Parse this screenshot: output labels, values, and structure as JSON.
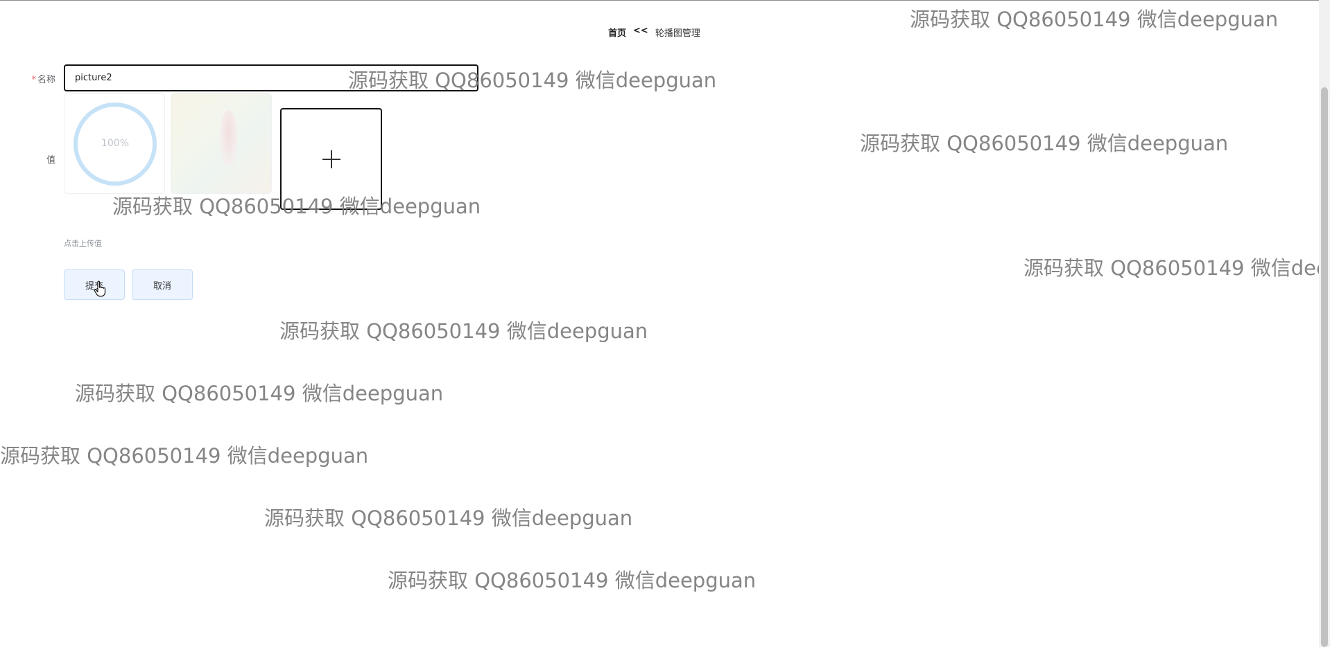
{
  "breadcrumb": {
    "home": "首页",
    "separator": "<<",
    "current": "轮播图管理"
  },
  "form": {
    "name_label": "名称",
    "required_mark": "*",
    "name_value": "picture2",
    "value_label": "值",
    "upload_progress": "100%",
    "upload_progress_fraction": 1.0,
    "upload_tip": "点击上传值"
  },
  "buttons": {
    "submit": "提交",
    "cancel": "取消"
  },
  "watermark": {
    "text": "源码获取 QQ86050149 微信deepguan",
    "text_clipped": "源码获取 QQ86050149 微信dee"
  },
  "colors": {
    "button_bg": "#ecf5ff",
    "required": "#f56c6c",
    "progress_ring": "#c6e2f7"
  }
}
